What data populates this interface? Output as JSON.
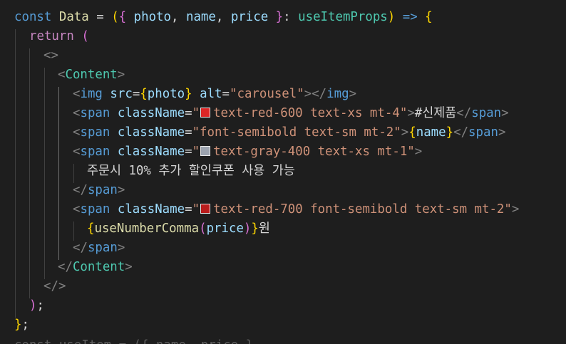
{
  "editor": {
    "colors": {
      "background": "#1e1e1e",
      "red_600": "#dc2626",
      "gray_400": "#9ca3af",
      "red_700": "#b91c1c"
    },
    "tokens": {
      "const": "const",
      "data_name": "Data",
      "eq": "=",
      "open_paren": "(",
      "open_brace": "{",
      "param_photo": "photo",
      "comma": ",",
      "param_name": "name",
      "param_price": "price",
      "close_brace": "}",
      "colon": ":",
      "props_type": "useItemProps",
      "close_paren": ")",
      "arrow": "=>",
      "return": "return",
      "frag_open": "<>",
      "lt": "<",
      "gt": ">",
      "lt_slash": "</",
      "self_close": "/>",
      "content_tag": "Content",
      "img_tag": "img",
      "src_attr": "src",
      "photo_ref": "photo",
      "alt_attr": "alt",
      "alt_value": "\"carousel\"",
      "span_tag": "span",
      "classname_attr": "className",
      "quote": "\"",
      "class_red600": "text-red-600 text-xs mt-4",
      "new_product_text": "#신제품",
      "class_name_span": "\"font-semibold text-sm mt-2\"",
      "name_ref": "name",
      "class_gray400": "text-gray-400 text-xs mt-1",
      "coupon_text": "주문시 10% 추가 할인쿠폰 사용 가능",
      "class_red700": "text-red-700 font-semibold text-sm mt-2",
      "use_number_comma": "useNumberComma",
      "price_ref": "price",
      "won_text": "원",
      "frag_close": "</>",
      "close_paren_semi": ");",
      "close_brace_semi": "};",
      "semi": ";",
      "next_line_partial": "const useItem = ({ name, price }"
    }
  }
}
